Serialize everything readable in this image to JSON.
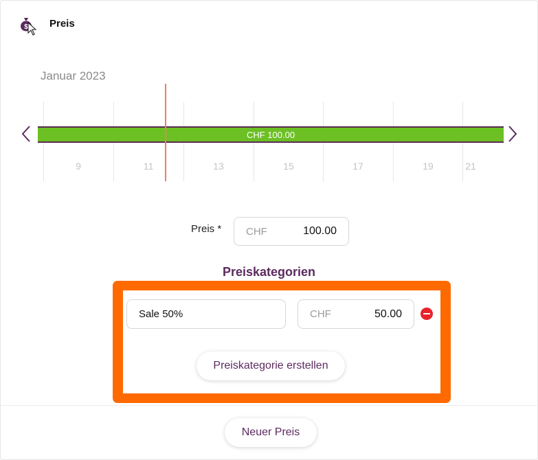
{
  "header": {
    "title": "Preis",
    "icon": "money-bag-icon"
  },
  "timeline": {
    "month": "Januar 2023",
    "day_labels": [
      "9",
      "11",
      "13",
      "15",
      "17",
      "19",
      "21"
    ],
    "bar_label": "CHF 100.00",
    "bar_color": "#6cc024",
    "today_line_color": "#f07a6a"
  },
  "price": {
    "label": "Preis *",
    "currency": "CHF",
    "value": "100.00"
  },
  "categories": {
    "title": "Preiskategorien",
    "items": [
      {
        "name": "Sale 50%",
        "currency": "CHF",
        "value": "50.00"
      }
    ],
    "create_button": "Preiskategorie erstellen"
  },
  "footer": {
    "new_price_button": "Neuer Preis"
  },
  "colors": {
    "accent": "#5b2a5e",
    "highlight": "#ff6a00",
    "remove": "#e8232a"
  }
}
